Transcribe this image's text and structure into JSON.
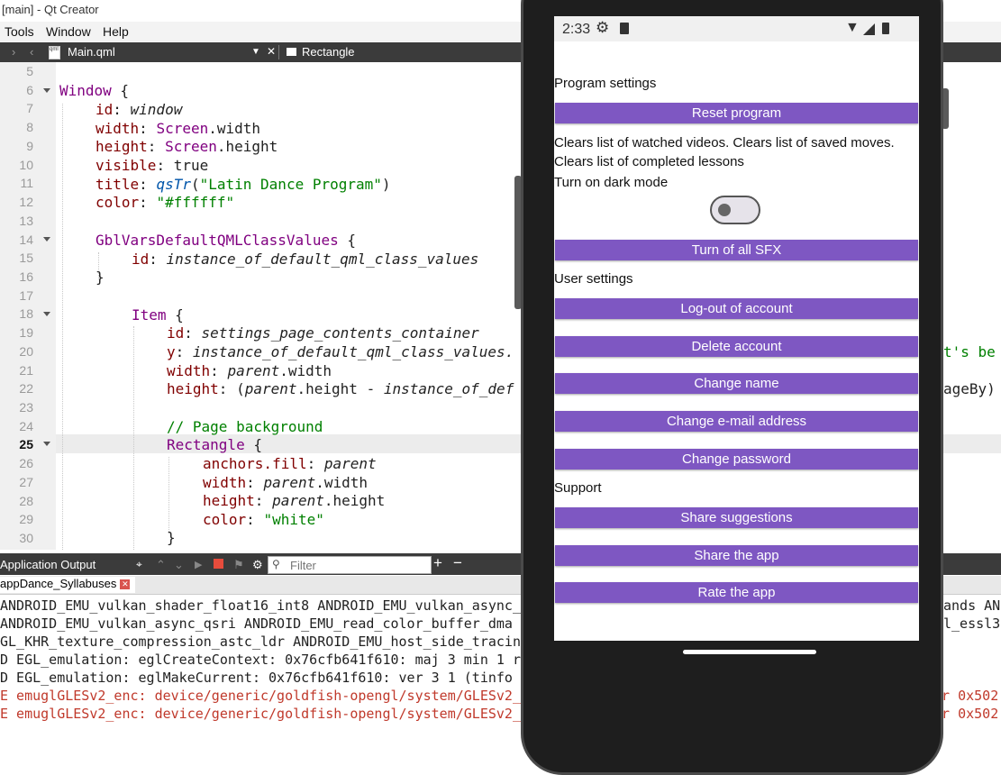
{
  "window": {
    "title": "[main] - Qt Creator",
    "menu": [
      "Tools",
      "Window",
      "Help"
    ]
  },
  "editor": {
    "file_tab": "Main.qml",
    "file_icon_text": "qml",
    "close_glyph": "✕",
    "symbol_tab": "Rectangle",
    "line_numbers": [
      "5",
      "6",
      "7",
      "8",
      "9",
      "10",
      "11",
      "12",
      "13",
      "14",
      "15",
      "16",
      "17",
      "18",
      "19",
      "20",
      "21",
      "22",
      "23",
      "24",
      "25",
      "26",
      "27",
      "28",
      "29",
      "30"
    ],
    "code": {
      "l6_kw": "Window",
      "l6_rest": " {",
      "l7_prop": "id",
      "l7_val": "window",
      "l8_prop": "width",
      "l8_obj": "Screen",
      "l8_rest": ".width",
      "l9_prop": "height",
      "l9_obj": "Screen",
      "l9_rest": ".height",
      "l10_prop": "visible",
      "l10_val": "true",
      "l11_prop": "title",
      "l11_fn": "qsTr",
      "l11_str": "\"Latin Dance Program\"",
      "l12_prop": "color",
      "l12_str": "\"#ffffff\"",
      "l14_type": "GblVarsDefaultQMLClassValues",
      "l15_prop": "id",
      "l15_val": "instance_of_default_qml_class_values",
      "l18_type": "Item",
      "l19_prop": "id",
      "l19_val": "settings_page_contents_container",
      "l20_prop": "y",
      "l20_val": "instance_of_default_qml_class_values.",
      "l20_tail": "t's be",
      "l21_prop": "width",
      "l21_val": "parent",
      "l21_rest": ".width",
      "l22_prop": "height",
      "l22_open": "(",
      "l22_val": "parent",
      "l22_mid": ".height - ",
      "l22_val2": "instance_of_def",
      "l22_tail": "ageBy)",
      "l24_comment": "// Page background",
      "l25_type": "Rectangle",
      "l26_prop": "anchors.fill",
      "l26_val": "parent",
      "l27_prop": "width",
      "l27_val": "parent",
      "l27_rest": ".width",
      "l28_prop": "height",
      "l28_val": "parent",
      "l28_rest": ".height",
      "l29_prop": "color",
      "l29_str": "\"white\"",
      "brace_open": " {",
      "brace_close": "}",
      "colon": ": ",
      "paren_close": ")"
    }
  },
  "output_panel": {
    "title": "Application Output",
    "filter_placeholder": "Filter",
    "tab_label": "appDance_Syllabuses",
    "lines": [
      "ANDROID_EMU_vulkan_shader_float16_int8 ANDROID_EMU_vulkan_async_qu",
      "ANDROID_EMU_vulkan_async_qsri ANDROID_EMU_read_color_buffer_dma AN",
      "GL_KHR_texture_compression_astc_ldr ANDROID_EMU_host_side_tracing",
      "D EGL_emulation: eglCreateContext: 0x76cfb641f610: maj 3 min 1 rcv",
      "D EGL_emulation: eglMakeCurrent: 0x76cfb641f610: ver 3 1 (tinfo 0x",
      "E emuglGLESv2_enc: device/generic/goldfish-opengl/system/GLESv2_en",
      "E emuglGLESv2_enc: device/generic/goldfish-opengl/system/GLESv2_en"
    ],
    "right_tails": [
      "ands AN",
      "l_essl3",
      "",
      "",
      "",
      "or 0x502",
      "or 0x502"
    ]
  },
  "phone": {
    "clock": "2:33",
    "sections": {
      "program": "Program settings",
      "user": "User settings",
      "support": "Support"
    },
    "buttons": {
      "reset": "Reset program",
      "sfx": "Turn of all SFX",
      "logout": "Log-out of account",
      "delete": "Delete account",
      "change_name": "Change name",
      "change_email": "Change e-mail address",
      "change_password": "Change password",
      "share_suggestions": "Share suggestions",
      "share_app": "Share the app",
      "rate_app": "Rate the app"
    },
    "reset_description_1": "Clears list of watched videos. Clears list of saved moves.",
    "reset_description_2": "Clears list of completed lessons",
    "dark_mode_label": "Turn on dark mode",
    "dark_mode_on": false,
    "accent_color": "#7e57c2"
  },
  "icons": [
    "settings-gear-icon",
    "sim-card-icon",
    "wifi-icon",
    "signal-icon",
    "battery-icon",
    "qml-file-icon",
    "rectangle-symbol-icon",
    "run-icon",
    "stop-icon",
    "gear-icon",
    "search-icon",
    "plus-icon",
    "minus-icon",
    "close-tab-icon"
  ]
}
